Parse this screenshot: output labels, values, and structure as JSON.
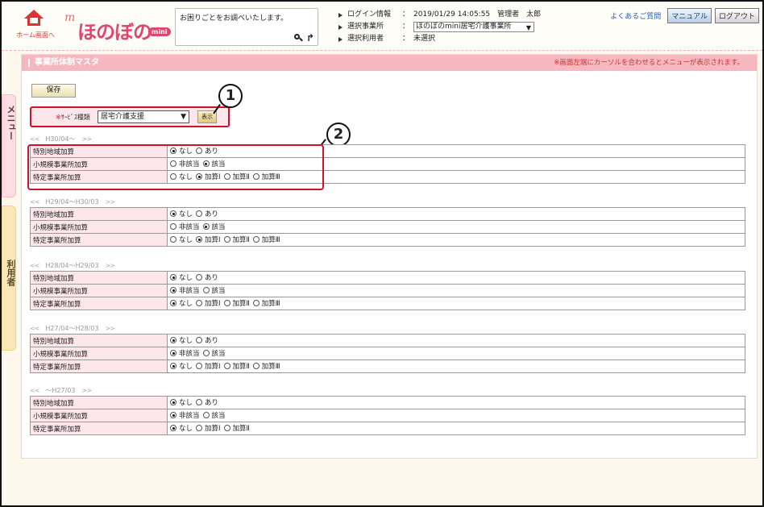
{
  "header": {
    "home_label": "ホーム画面へ",
    "logo_text": "ほのぼの",
    "logo_mini": "mini",
    "help_text": "お困りごとをお調べいたします。",
    "login_label": "ログイン情報",
    "login_value": "2019/01/29 14:05:55　管理者　太郎",
    "office_label": "選択事業所",
    "office_value": "ほのぼのmini居宅介護事業所",
    "user_label": "選択利用者",
    "user_value": "未選択",
    "colon": "：",
    "faq_link": "よくあるご質問",
    "manual_btn": "マニュアル",
    "logout_btn": "ログアウト"
  },
  "side": {
    "menu": "メニュー",
    "user": "利用者"
  },
  "panel": {
    "title": "事業所体制マスタ",
    "note": "※画面左端にカーソルを合わせるとメニューが表示されます。",
    "save_btn": "保存",
    "service_req": "※",
    "service_label": "ｻｰﾋﾞｽ種類",
    "service_value": "居宅介護支援",
    "show_btn": "表示"
  },
  "callouts": {
    "one": "1",
    "two": "2"
  },
  "sections": [
    {
      "head": "H30/04～",
      "rows": [
        {
          "label": "特別地域加算",
          "options": [
            {
              "t": "なし",
              "on": true
            },
            {
              "t": "あり",
              "on": false
            }
          ]
        },
        {
          "label": "小規模事業所加算",
          "options": [
            {
              "t": "非該当",
              "on": false
            },
            {
              "t": "該当",
              "on": true
            }
          ]
        },
        {
          "label": "特定事業所加算",
          "options": [
            {
              "t": "なし",
              "on": false
            },
            {
              "t": "加算Ⅰ",
              "on": true
            },
            {
              "t": "加算Ⅱ",
              "on": false
            },
            {
              "t": "加算Ⅲ",
              "on": false
            }
          ]
        }
      ]
    },
    {
      "head": "H29/04～H30/03",
      "rows": [
        {
          "label": "特別地域加算",
          "options": [
            {
              "t": "なし",
              "on": true
            },
            {
              "t": "あり",
              "on": false
            }
          ]
        },
        {
          "label": "小規模事業所加算",
          "options": [
            {
              "t": "非該当",
              "on": false
            },
            {
              "t": "該当",
              "on": true
            }
          ]
        },
        {
          "label": "特定事業所加算",
          "options": [
            {
              "t": "なし",
              "on": false
            },
            {
              "t": "加算Ⅰ",
              "on": true
            },
            {
              "t": "加算Ⅱ",
              "on": false
            },
            {
              "t": "加算Ⅲ",
              "on": false
            }
          ]
        }
      ]
    },
    {
      "head": "H28/04～H29/03",
      "rows": [
        {
          "label": "特別地域加算",
          "options": [
            {
              "t": "なし",
              "on": true
            },
            {
              "t": "あり",
              "on": false
            }
          ]
        },
        {
          "label": "小規模事業所加算",
          "options": [
            {
              "t": "非該当",
              "on": true
            },
            {
              "t": "該当",
              "on": false
            }
          ]
        },
        {
          "label": "特定事業所加算",
          "options": [
            {
              "t": "なし",
              "on": true
            },
            {
              "t": "加算Ⅰ",
              "on": false
            },
            {
              "t": "加算Ⅱ",
              "on": false
            },
            {
              "t": "加算Ⅲ",
              "on": false
            }
          ]
        }
      ]
    },
    {
      "head": "H27/04～H28/03",
      "rows": [
        {
          "label": "特別地域加算",
          "options": [
            {
              "t": "なし",
              "on": true
            },
            {
              "t": "あり",
              "on": false
            }
          ]
        },
        {
          "label": "小規模事業所加算",
          "options": [
            {
              "t": "非該当",
              "on": true
            },
            {
              "t": "該当",
              "on": false
            }
          ]
        },
        {
          "label": "特定事業所加算",
          "options": [
            {
              "t": "なし",
              "on": true
            },
            {
              "t": "加算Ⅰ",
              "on": false
            },
            {
              "t": "加算Ⅱ",
              "on": false
            },
            {
              "t": "加算Ⅲ",
              "on": false
            }
          ]
        }
      ]
    },
    {
      "head": "～H27/03",
      "rows": [
        {
          "label": "特別地域加算",
          "options": [
            {
              "t": "なし",
              "on": true
            },
            {
              "t": "あり",
              "on": false
            }
          ]
        },
        {
          "label": "小規模事業所加算",
          "options": [
            {
              "t": "非該当",
              "on": true
            },
            {
              "t": "該当",
              "on": false
            }
          ]
        },
        {
          "label": "特定事業所加算",
          "options": [
            {
              "t": "なし",
              "on": true
            },
            {
              "t": "加算Ⅰ",
              "on": false
            },
            {
              "t": "加算Ⅱ",
              "on": false
            }
          ]
        }
      ]
    }
  ],
  "nav": {
    "prev": "<<",
    "next": ">>"
  }
}
